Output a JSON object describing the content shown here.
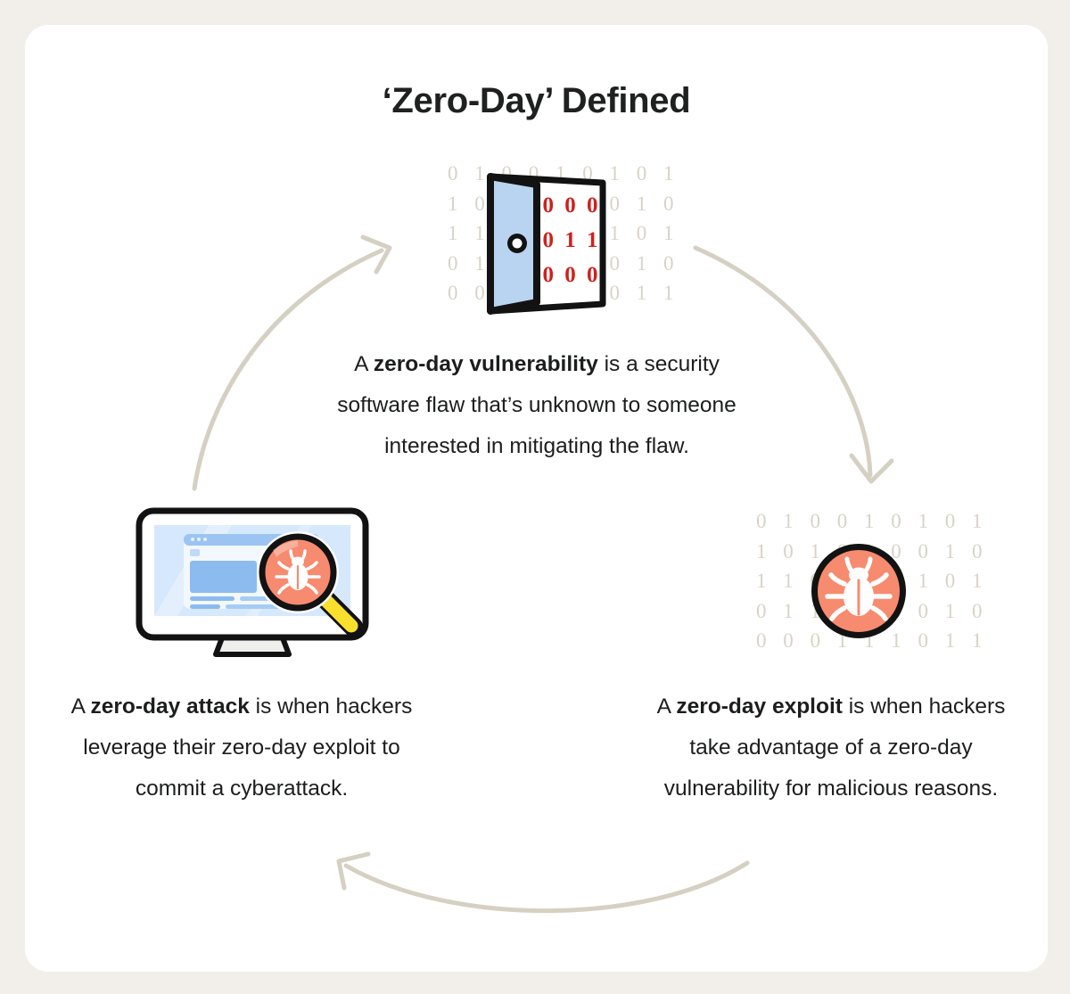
{
  "page": {
    "background_color": "#F2EFEB",
    "card_color": "#FFFFFF",
    "title": "‘Zero-Day’ Defined",
    "title_color": "#1F2120",
    "body_text_color": "#1C1E1D",
    "arrow_color": "#D6D0C3",
    "binary_color": "#D9D3C6",
    "accent_salmon": "#F78B6F",
    "accent_red": "#D0211C",
    "accent_blue": "#B8D4F0",
    "accent_yellow": "#FAE02C",
    "outline_black": "#121212"
  },
  "icons": {
    "door": {
      "name": "open-door-binary-icon",
      "binary_rows": [
        "0 1 0 0 1 0 1 0 1",
        "1 0 1 0 1 0 0 1 0",
        "1 1 0 1 1 0 1 0 1",
        "0 1 1 0 1 0 0 1 0",
        "0 0 0 1 1 1 0 1 1"
      ],
      "red_digits": [
        "0 0 0",
        "0 1 1",
        "0 0 0"
      ],
      "door_panel_color": "#B8D4F0",
      "handle": "door-knob"
    },
    "bug": {
      "name": "bug-in-circle-icon",
      "binary_rows": [
        "0 1 0 0 1 0 1 0 1",
        "1 0 1 0 1 0 0 1 0",
        "1 1 0 1 1 0 1 0 1",
        "0 1 1 0 1 0 0 1 0",
        "0 0 0 1 1 1 0 1 1"
      ],
      "circle_color": "#F78B6F",
      "bug_color": "#FFFFFF"
    },
    "monitor": {
      "name": "monitor-with-magnifier-icon",
      "screen_color": "#D6E8FB",
      "window_color": "#EFF6FE",
      "block_color": "#7FB2EF",
      "magnifier_lens_color": "#F78B6F",
      "magnifier_handle_color": "#FAE02C"
    }
  },
  "arrows": [
    {
      "name": "arrow-attack-to-vulnerability",
      "direction": "up-right",
      "from": "monitor",
      "to": "door"
    },
    {
      "name": "arrow-vulnerability-to-exploit",
      "direction": "down-right",
      "from": "door",
      "to": "bug"
    },
    {
      "name": "arrow-exploit-to-attack",
      "direction": "left",
      "from": "bug",
      "to": "monitor"
    }
  ],
  "sections": {
    "vulnerability": {
      "lead": "A ",
      "term": "zero-day vulnerability",
      "rest": " is a security software flaw that’s unknown to someone interested in mitigating the flaw."
    },
    "exploit": {
      "lead": "A ",
      "term": "zero-day exploit",
      "rest": " is when hackers take advantage of a zero-day vulnerability for malicious reasons."
    },
    "attack": {
      "lead": "A ",
      "term": "zero-day attack",
      "rest": " is when hackers leverage their zero-day exploit to commit a cyberattack."
    }
  }
}
